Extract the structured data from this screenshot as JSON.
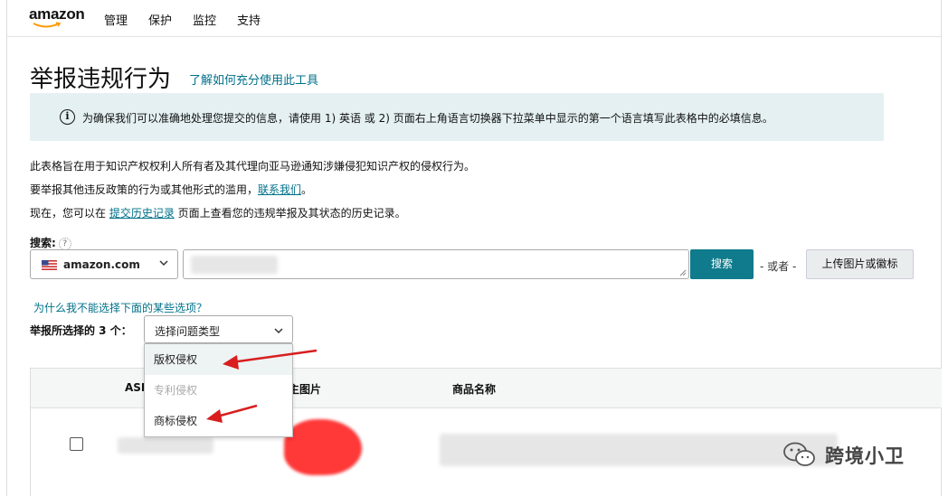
{
  "nav": {
    "logo": "amazon",
    "items": [
      "管理",
      "保护",
      "监控",
      "支持"
    ]
  },
  "page": {
    "title": "举报违规行为",
    "title_link": "了解如何充分使用此工具"
  },
  "info": {
    "icon": "info-icon",
    "text": "为确保我们可以准确地处理您提交的信息，请使用 1) 英语 或 2) 页面右上角语言切换器下拉菜单中显示的第一个语言填写此表格中的必填信息。"
  },
  "paragraphs": {
    "p1": "此表格旨在用于知识产权权利人所有者及其代理向亚马逊通知涉嫌侵犯知识产权的侵权行为。",
    "p2_before": "要举报其他违反政策的行为或其他形式的滥用，",
    "p2_link": "联系我们",
    "p2_after": "。",
    "p3_before": "现在，您可以在 ",
    "p3_link": "提交历史记录",
    "p3_after": " 页面上查看您的违规举报及其状态的历史记录。"
  },
  "search": {
    "label": "搜索:",
    "help": "?",
    "marketplace": "amazon.com",
    "button": "搜索",
    "or_text": "- 或者 -",
    "upload_button": "上传图片或徽标"
  },
  "report": {
    "why_link": "为什么我不能选择下面的某些选项？",
    "label": "举报所选择的 3 个：",
    "select_placeholder": "选择问题类型",
    "options": [
      {
        "label": "版权侵权",
        "disabled": false
      },
      {
        "label": "专利侵权",
        "disabled": true
      },
      {
        "label": "商标侵权",
        "disabled": false
      }
    ]
  },
  "table": {
    "headers": [
      "ASI",
      "主图片",
      "商品名称"
    ]
  },
  "watermark": {
    "text": "跨境小卫",
    "icon": "wechat-icon"
  },
  "colors": {
    "link": "#00718a",
    "primary_button": "#0f7b8c",
    "info_bg": "#e4f0f2",
    "annotation_arrow": "#d81e1e"
  }
}
